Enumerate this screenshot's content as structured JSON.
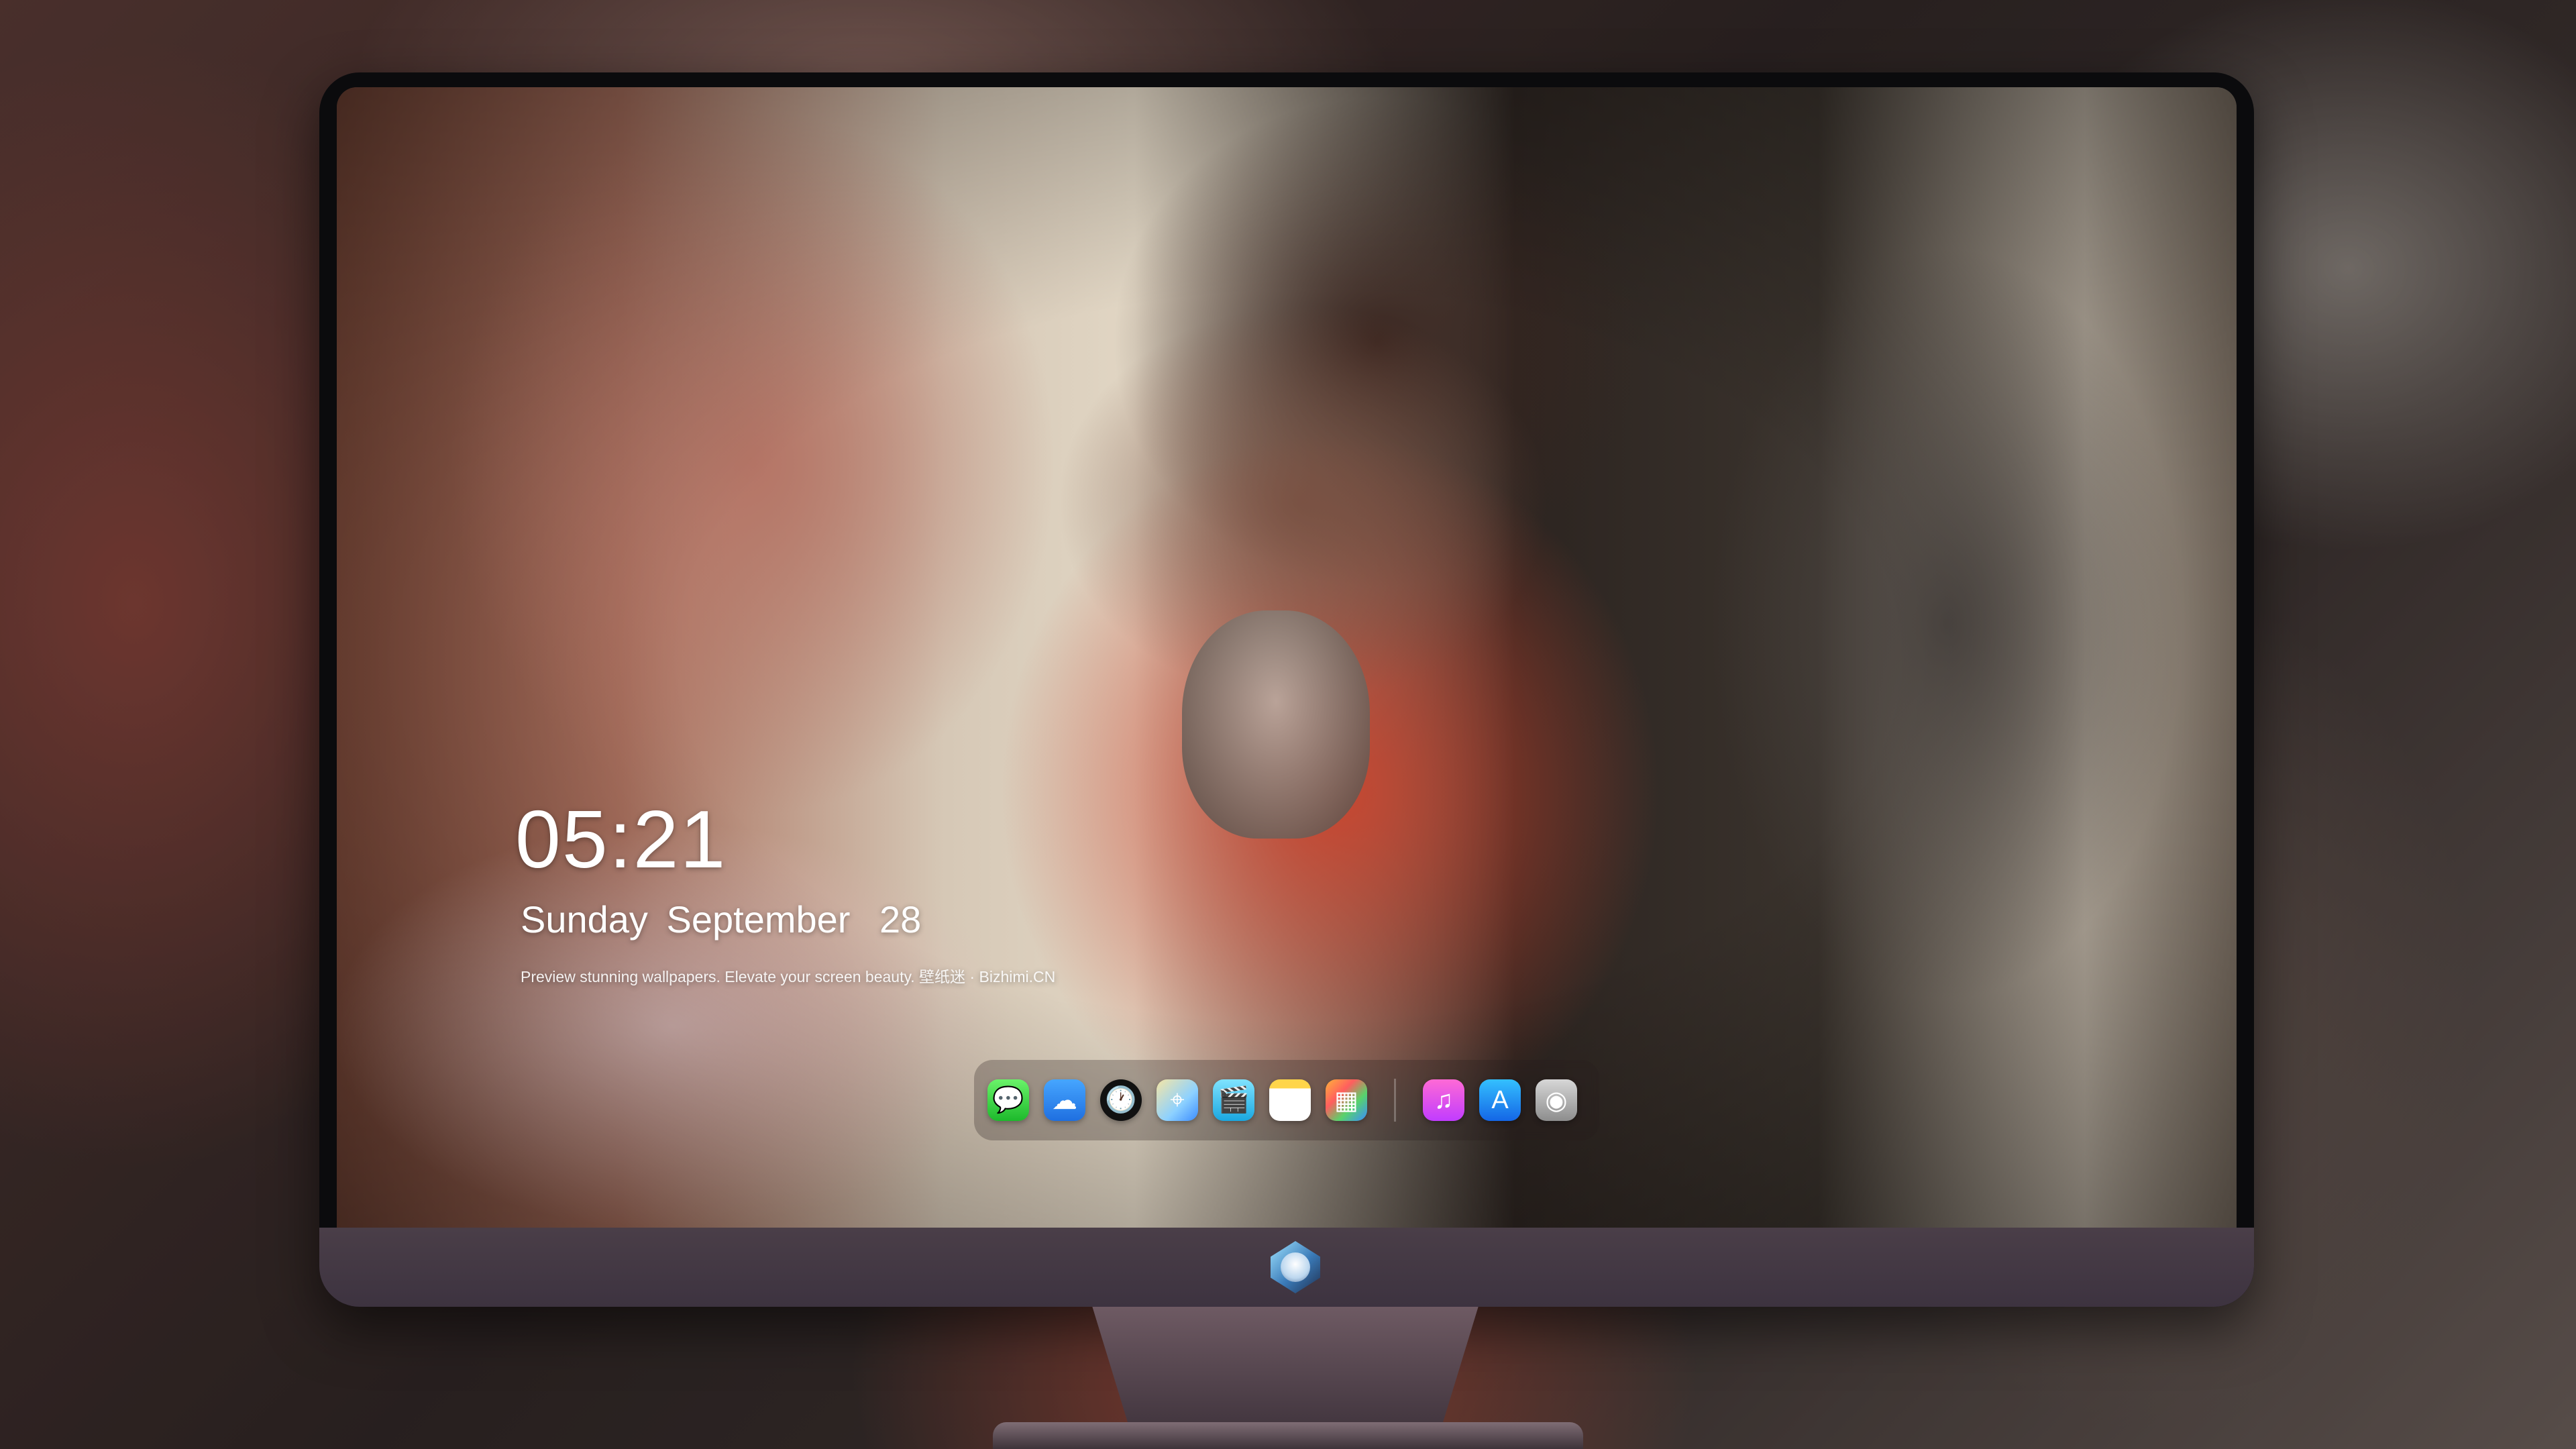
{
  "lockscreen": {
    "time": "05:21",
    "weekday": "Sunday",
    "month": "September",
    "day": "28",
    "tagline": "Preview stunning wallpapers. Elevate your screen beauty. 壁纸迷 · Bizhimi.CN"
  },
  "dock": {
    "apps": [
      {
        "name": "messages-icon",
        "glyph": "💬"
      },
      {
        "name": "weather-icon",
        "glyph": "☁"
      },
      {
        "name": "clock-icon",
        "glyph": "🕐"
      },
      {
        "name": "maps-icon",
        "glyph": "⌖"
      },
      {
        "name": "clips-icon",
        "glyph": "🎬"
      },
      {
        "name": "notes-icon",
        "glyph": ""
      },
      {
        "name": "photos-icon",
        "glyph": "▦"
      }
    ],
    "apps_right": [
      {
        "name": "music-icon",
        "glyph": "♫"
      },
      {
        "name": "app-store-icon",
        "glyph": "A"
      },
      {
        "name": "camera-icon",
        "glyph": "◉"
      }
    ]
  },
  "colors": {
    "chin": "#4a3e48",
    "bezel": "#0b0b0d",
    "sweater": "#c8452f"
  }
}
